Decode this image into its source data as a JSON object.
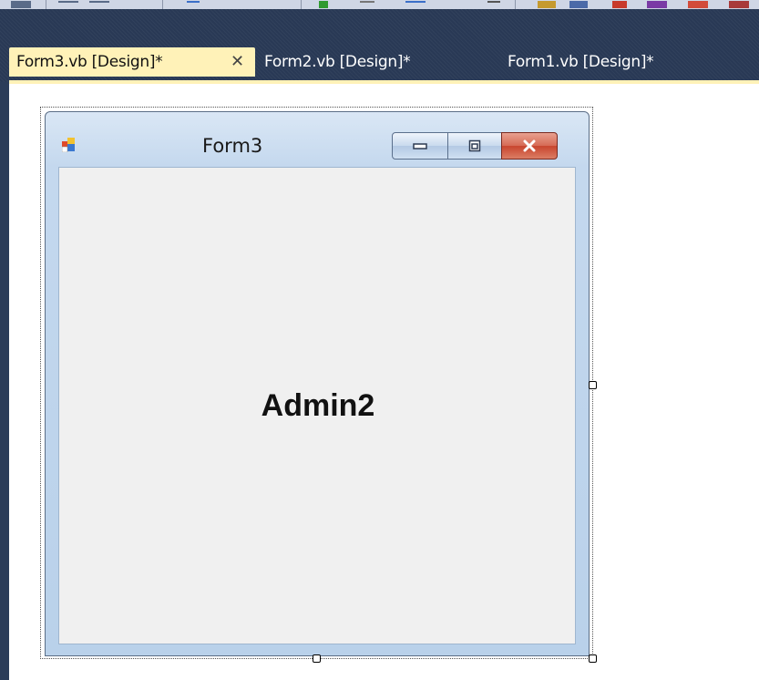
{
  "tabs": [
    {
      "label": "Form3.vb [Design]*",
      "active": true,
      "close_glyph": "✕"
    },
    {
      "label": "Form2.vb [Design]*",
      "active": false
    },
    {
      "label": "Form1.vb [Design]*",
      "active": false
    }
  ],
  "form": {
    "title": "Form3",
    "icon": "form-app-icon",
    "label_text": "Admin2"
  },
  "icons": [
    "minimize-icon",
    "maximize-icon",
    "close-icon"
  ],
  "colors": {
    "tab_active_bg": "#fff2b8",
    "tab_band_bg": "#293955",
    "client_bg": "#f0f0f0",
    "close_button": "#c8452e"
  }
}
